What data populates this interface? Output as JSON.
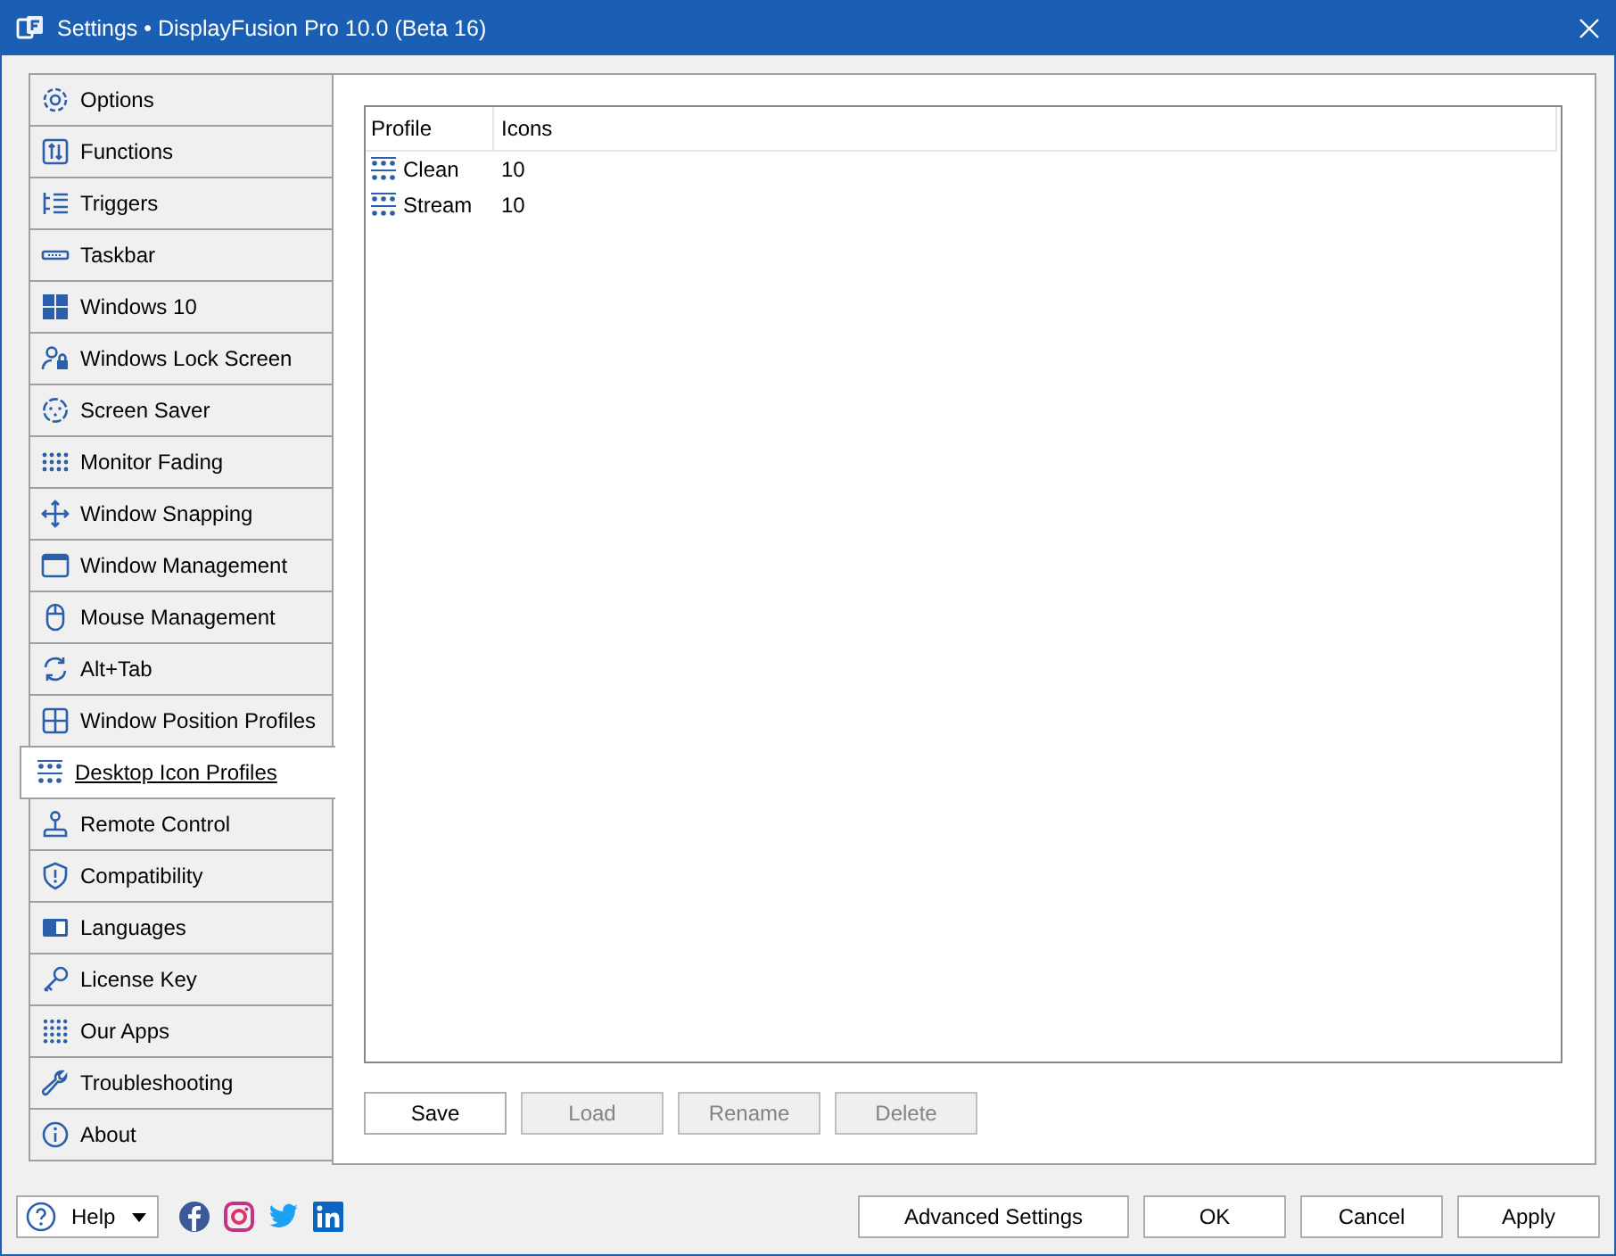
{
  "window": {
    "title": "Settings • DisplayFusion Pro 10.0 (Beta 16)"
  },
  "sidebar": {
    "items": [
      {
        "label": "Options",
        "selected": false
      },
      {
        "label": "Functions",
        "selected": false
      },
      {
        "label": "Triggers",
        "selected": false
      },
      {
        "label": "Taskbar",
        "selected": false
      },
      {
        "label": "Windows 10",
        "selected": false
      },
      {
        "label": "Windows Lock Screen",
        "selected": false
      },
      {
        "label": "Screen Saver",
        "selected": false
      },
      {
        "label": "Monitor Fading",
        "selected": false
      },
      {
        "label": "Window Snapping",
        "selected": false
      },
      {
        "label": "Window Management",
        "selected": false
      },
      {
        "label": "Mouse Management",
        "selected": false
      },
      {
        "label": "Alt+Tab",
        "selected": false
      },
      {
        "label": "Window Position Profiles",
        "selected": false
      },
      {
        "label": "Desktop Icon Profiles",
        "selected": true
      },
      {
        "label": "Remote Control",
        "selected": false
      },
      {
        "label": "Compatibility",
        "selected": false
      },
      {
        "label": "Languages",
        "selected": false
      },
      {
        "label": "License Key",
        "selected": false
      },
      {
        "label": "Our Apps",
        "selected": false
      },
      {
        "label": "Troubleshooting",
        "selected": false
      },
      {
        "label": "About",
        "selected": false
      }
    ]
  },
  "table": {
    "columns": [
      "Profile",
      "Icons"
    ],
    "rows": [
      {
        "profile": "Clean",
        "icons": "10"
      },
      {
        "profile": "Stream",
        "icons": "10"
      }
    ]
  },
  "actions": [
    {
      "label": "Save",
      "disabled": false
    },
    {
      "label": "Load",
      "disabled": true
    },
    {
      "label": "Rename",
      "disabled": true
    },
    {
      "label": "Delete",
      "disabled": true
    }
  ],
  "footer": {
    "help": "Help",
    "buttons": [
      "Advanced Settings",
      "OK",
      "Cancel",
      "Apply"
    ]
  }
}
